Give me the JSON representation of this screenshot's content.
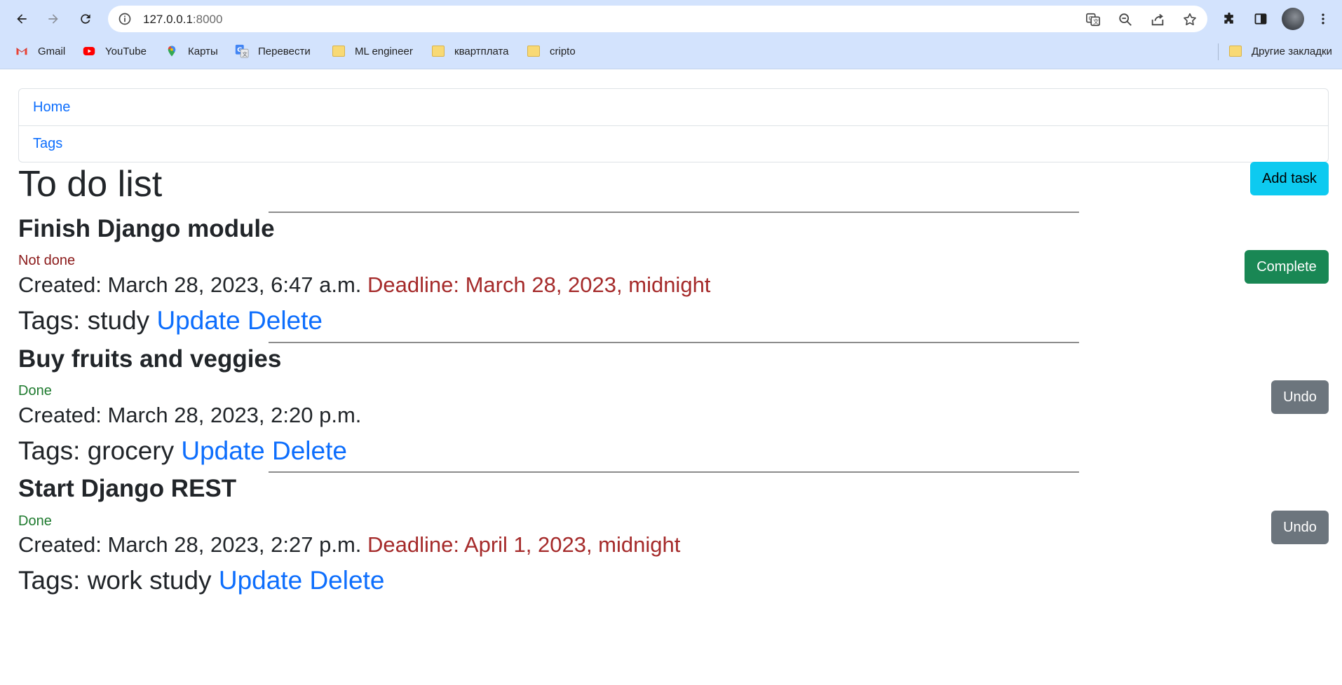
{
  "browser": {
    "url_host": "127.0.0.1",
    "url_port": ":8000",
    "bookmarks": [
      {
        "label": "Gmail",
        "icon": "gmail-icon"
      },
      {
        "label": "YouTube",
        "icon": "youtube-icon"
      },
      {
        "label": "Карты",
        "icon": "maps-icon"
      },
      {
        "label": "Перевести",
        "icon": "translate-icon"
      },
      {
        "label": "ML engineer",
        "icon": "folder-icon"
      },
      {
        "label": "квартплата",
        "icon": "folder-icon"
      },
      {
        "label": "cripto",
        "icon": "folder-icon"
      }
    ],
    "other_bookmarks": "Другие закладки"
  },
  "nav": {
    "items": [
      {
        "label": "Home"
      },
      {
        "label": "Tags"
      }
    ]
  },
  "page": {
    "title": "To do list",
    "add_task_label": "Add task"
  },
  "tasks": [
    {
      "title": "Finish Django module",
      "status": "Not done",
      "created": "Created: March 28, 2023, 6:47 a.m.",
      "deadline": "Deadline: March 28, 2023, midnight",
      "tags": "Tags: study",
      "update_label": "Update",
      "delete_label": "Delete",
      "action_label": "Complete"
    },
    {
      "title": "Buy fruits and veggies",
      "status": "Done",
      "created": "Created: March 28, 2023, 2:20 p.m.",
      "deadline": "",
      "tags": "Tags: grocery",
      "update_label": "Update",
      "delete_label": "Delete",
      "action_label": "Undo"
    },
    {
      "title": "Start Django REST",
      "status": "Done",
      "created": "Created: March 28, 2023, 2:27 p.m.",
      "deadline": "Deadline: April 1, 2023, midnight",
      "tags": "Tags: work study",
      "update_label": "Update",
      "delete_label": "Delete",
      "action_label": "Undo"
    }
  ],
  "colors": {
    "link": "#0d6efd",
    "deadline": "#a52a2a",
    "not_done": "#8b1a1a",
    "done": "#1e7a2e",
    "btn_info": "#0dcaf0",
    "btn_success": "#198754",
    "btn_secondary": "#6c757d"
  }
}
